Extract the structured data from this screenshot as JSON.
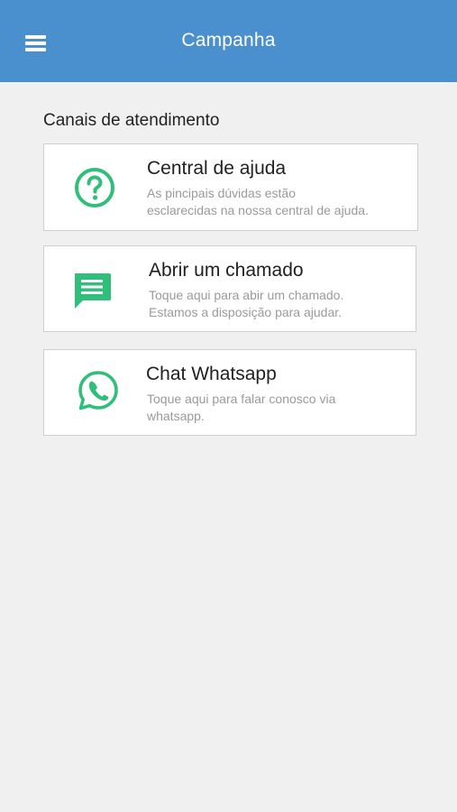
{
  "header": {
    "title": "Campanha",
    "menu_icon": "menu-icon",
    "background_color": "#4a90cf"
  },
  "section": {
    "title": "Canais de atendimento"
  },
  "accent_color": "#2fbf7a",
  "cards": [
    {
      "icon": "help-circle-icon",
      "title": "Central de ajuda",
      "desc_line1": "As pincipais dúvidas estão",
      "desc_line2": "esclarecidas na nossa central de ajuda."
    },
    {
      "icon": "message-icon",
      "title": "Abrir um chamado",
      "desc_line1": "Toque aqui para abir um chamado.",
      "desc_line2": "Estamos a disposição para ajudar."
    },
    {
      "icon": "whatsapp-icon",
      "title": "Chat Whatsapp",
      "desc_line1": "Toque aqui para falar conosco via",
      "desc_line2": "whatsapp."
    }
  ]
}
